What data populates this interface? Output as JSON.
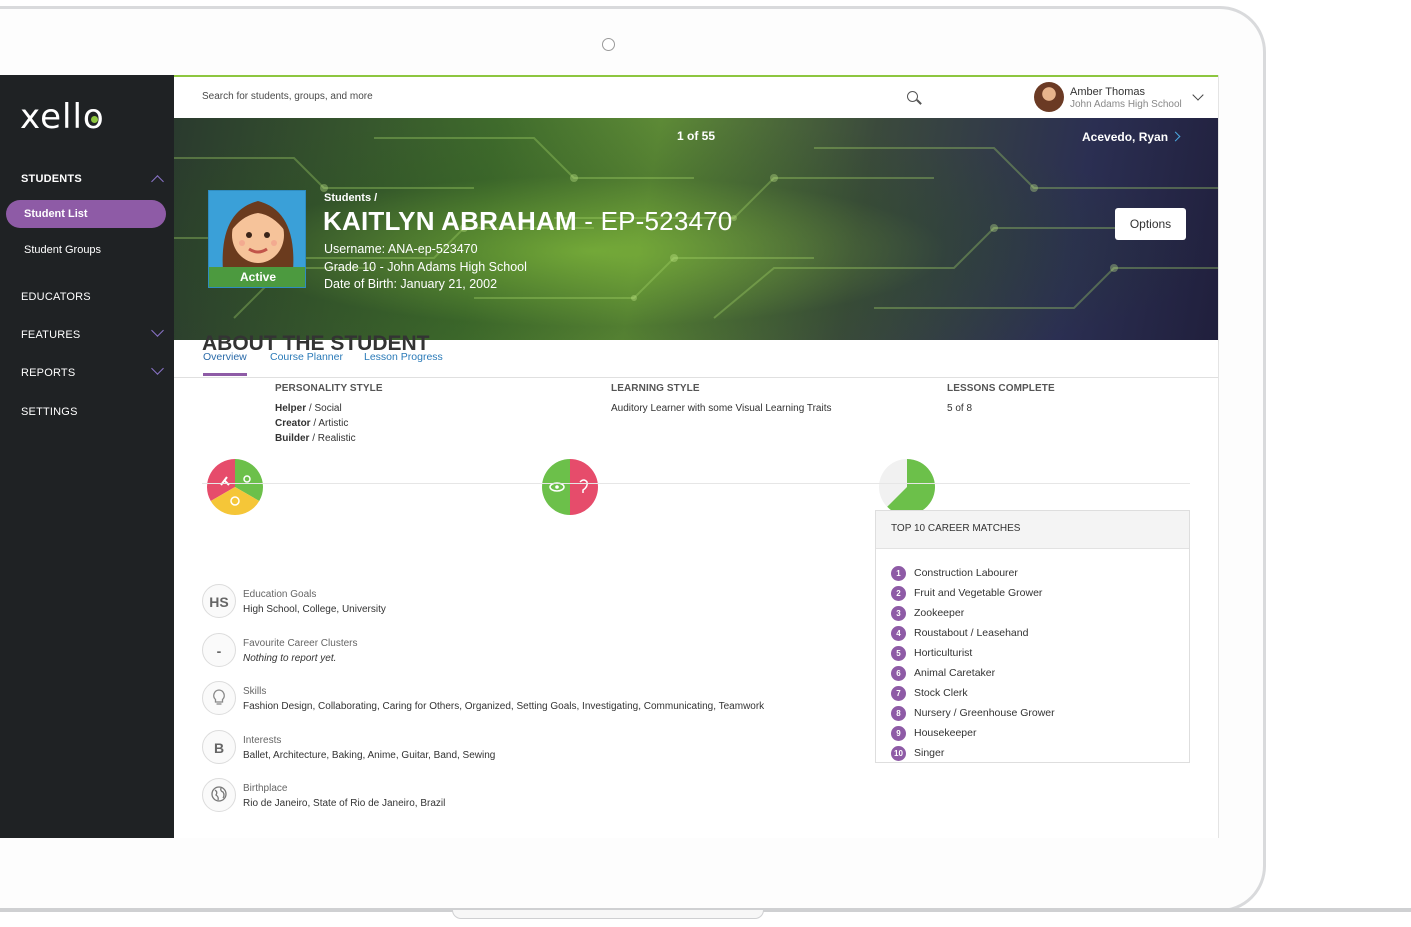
{
  "topbar": {
    "search_placeholder": "Search for students, groups, and more",
    "user_name": "Amber Thomas",
    "user_school": "John Adams High School"
  },
  "sidebar": {
    "logo": "xello",
    "sections": [
      {
        "label": "STUDENTS"
      },
      {
        "label": "EDUCATORS"
      },
      {
        "label": "FEATURES"
      },
      {
        "label": "REPORTS"
      },
      {
        "label": "SETTINGS"
      }
    ],
    "sub_items": [
      {
        "label": "Student List"
      },
      {
        "label": "Student Groups"
      }
    ],
    "accent": "#8e5ba6"
  },
  "hero": {
    "pager": "1 of 55",
    "next_student": "Acevedo, Ryan",
    "breadcrumb": "Students /",
    "name": "KAITLYN ABRAHAM",
    "id": " - EP-523470",
    "username": "Username: ANA-ep-523470",
    "grade": "Grade 10 - John Adams High School",
    "dob": "Date of Birth: January 21, 2002",
    "status": "Active",
    "options_label": "Options"
  },
  "tabs": [
    {
      "label": "Overview"
    },
    {
      "label": "Course Planner"
    },
    {
      "label": "Lesson Progress"
    }
  ],
  "about": {
    "title_bold": "ABOUT",
    "title_rest": " THE STUDENT",
    "personality": {
      "label": "PERSONALITY STYLE",
      "lines": [
        {
          "type": "Helper",
          "desc": " / Social"
        },
        {
          "type": "Creator",
          "desc": " / Artistic"
        },
        {
          "type": "Builder",
          "desc": " / Realistic"
        }
      ]
    },
    "learning": {
      "label": "LEARNING STYLE",
      "value": "Auditory Learner with some Visual Learning Traits"
    },
    "lessons": {
      "label": "LESSONS COMPLETE",
      "value": "5 of 8",
      "completed": 5,
      "total": 8
    }
  },
  "details": [
    {
      "icon": "HS",
      "label": "Education Goals",
      "value": "High School, College, University"
    },
    {
      "icon": "-",
      "label": "Favourite Career Clusters",
      "value": "Nothing to report yet."
    },
    {
      "icon": "",
      "label": "Skills",
      "value": "Fashion Design, Collaborating, Caring for Others, Organized, Setting Goals, Investigating, Communicating, Teamwork"
    },
    {
      "icon": "B",
      "label": "Interests",
      "value": "Ballet, Architecture, Baking, Anime, Guitar, Band, Sewing"
    },
    {
      "icon": "",
      "label": "Birthplace",
      "value": "Rio de Janeiro, State of Rio de Janeiro, Brazil"
    }
  ],
  "career": {
    "title": "TOP 10 CAREER MATCHES",
    "items": [
      {
        "num": "1",
        "name": "Construction Labourer"
      },
      {
        "num": "2",
        "name": "Fruit and Vegetable Grower"
      },
      {
        "num": "3",
        "name": "Zookeeper"
      },
      {
        "num": "4",
        "name": "Roustabout / Leasehand"
      },
      {
        "num": "5",
        "name": "Horticulturist"
      },
      {
        "num": "6",
        "name": "Animal Caretaker"
      },
      {
        "num": "7",
        "name": "Stock Clerk"
      },
      {
        "num": "8",
        "name": "Nursery / Greenhouse Grower"
      },
      {
        "num": "9",
        "name": "Housekeeper"
      },
      {
        "num": "10",
        "name": "Singer"
      }
    ]
  }
}
